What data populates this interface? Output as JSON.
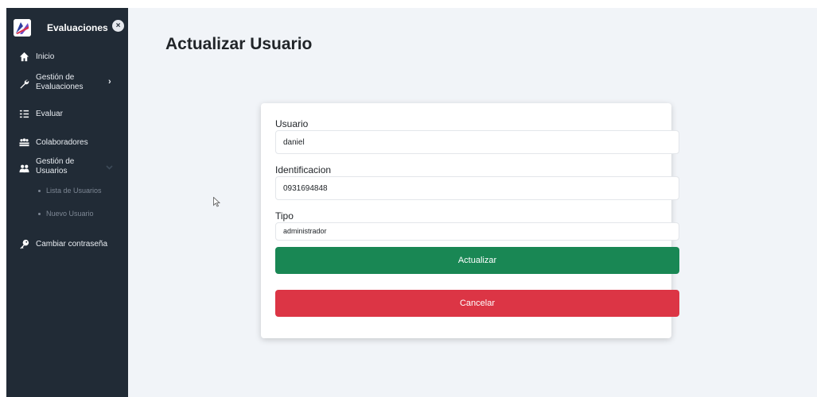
{
  "app": {
    "title": "Evaluaciones"
  },
  "sidebar": {
    "items": [
      {
        "label": "Inicio",
        "icon": "home-icon"
      },
      {
        "label": "Gestión de\nEvaluaciones",
        "icon": "wrench-icon"
      },
      {
        "label": "Evaluar",
        "icon": "list-icon"
      },
      {
        "label": "Colaboradores",
        "icon": "users-icon"
      },
      {
        "label": "Gestión de\nUsuarios",
        "icon": "user-group-icon"
      },
      {
        "label": "Cambiar contraseña",
        "icon": "key-icon"
      }
    ],
    "subitems": [
      {
        "label": "Lista de Usuarios"
      },
      {
        "label": "Nuevo Usuario"
      }
    ]
  },
  "page": {
    "title": "Actualizar Usuario"
  },
  "form": {
    "usuario_label": "Usuario",
    "usuario_value": "daniel",
    "identificacion_label": "Identificacion",
    "identificacion_value": "0931694848",
    "tipo_label": "Tipo",
    "tipo_value": "administrador",
    "update_label": "Actualizar",
    "cancel_label": "Cancelar"
  },
  "colors": {
    "sidebar_bg": "#212b36",
    "page_bg": "#f1f4f8",
    "success": "#198754",
    "danger": "#dc3545"
  }
}
